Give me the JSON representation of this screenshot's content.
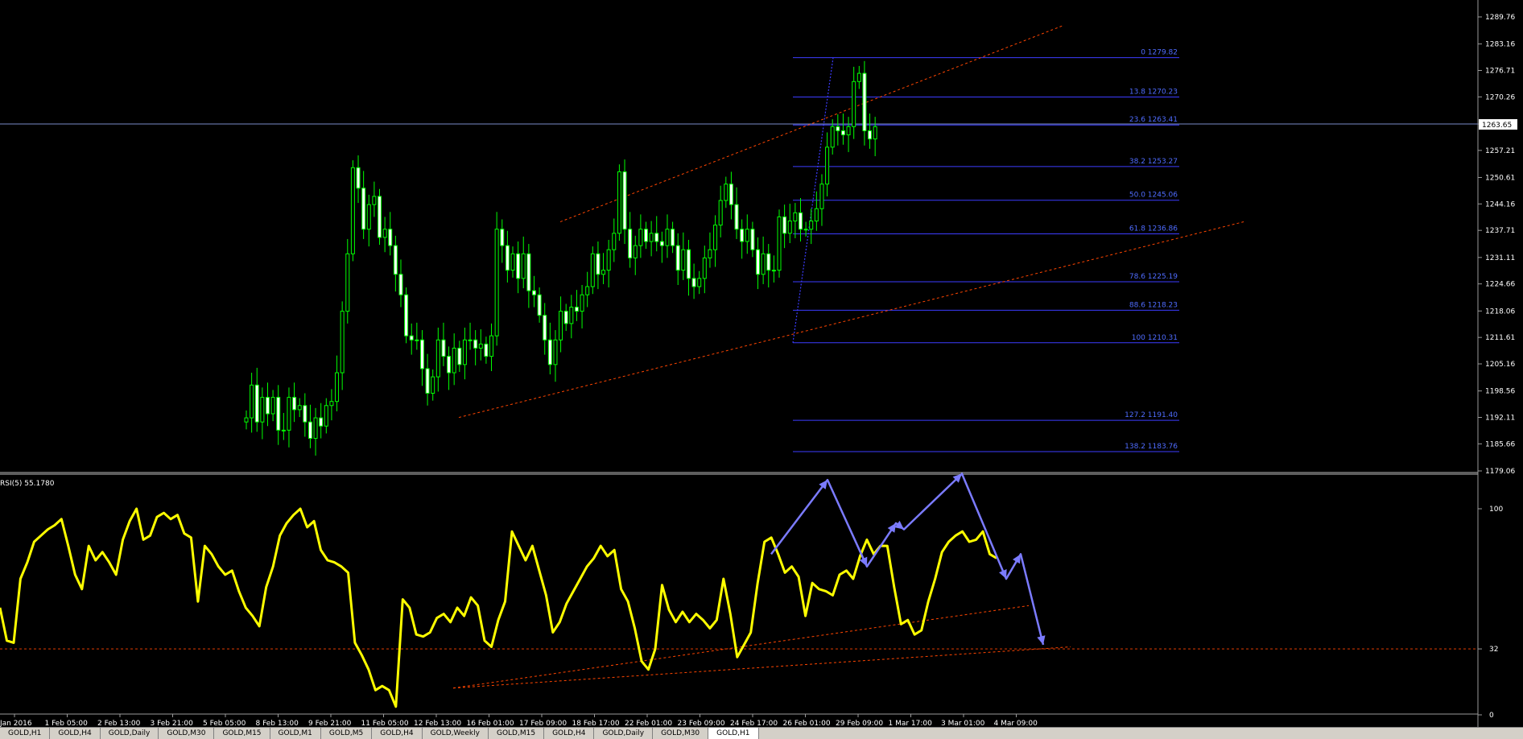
{
  "colors": {
    "background": "#000000",
    "bull_candle": "#00ff00",
    "bear_candle": "#ffffff",
    "fib_line": "#3c3cff",
    "fib_text": "#4f6cff",
    "trend_line": "#ff4500",
    "rsi_line": "#ffff00",
    "annotation_arrow": "#7b7bff",
    "axis_text": "#ffffff",
    "current_price_line": "#7a8cc8"
  },
  "chart_data": [
    {
      "type": "candlestick",
      "title": "",
      "ylim": [
        1179.06,
        1292.5
      ],
      "price_axis_ticks": [
        "1289.76",
        "1283.16",
        "1276.71",
        "1270.26",
        "1263.65",
        "1257.21",
        "1250.61",
        "1244.16",
        "1237.71",
        "1231.11",
        "1224.66",
        "1218.06",
        "1211.61",
        "1205.16",
        "1198.56",
        "1192.11",
        "1185.66",
        "1179.06"
      ],
      "current_price": "1263.65",
      "closes": [
        1192,
        1200,
        1191,
        1197,
        1193,
        1197,
        1189,
        1189,
        1197,
        1194,
        1195,
        1191,
        1187,
        1192,
        1190,
        1195,
        1196,
        1203,
        1218,
        1232,
        1253,
        1248,
        1238,
        1244,
        1246,
        1236,
        1238,
        1234,
        1227,
        1222,
        1212,
        1211,
        1211,
        1204,
        1198,
        1202,
        1211,
        1207,
        1203,
        1209,
        1205,
        1211,
        1211,
        1209,
        1210,
        1207,
        1212,
        1238,
        1234,
        1228,
        1232,
        1226,
        1232,
        1223,
        1222,
        1217,
        1211,
        1205,
        1211,
        1218,
        1215,
        1219,
        1218,
        1222,
        1224,
        1232,
        1227,
        1228,
        1233,
        1237,
        1252,
        1238,
        1231,
        1234,
        1238,
        1235,
        1237,
        1235,
        1234,
        1238,
        1234,
        1228,
        1233,
        1226,
        1224,
        1226,
        1231,
        1233,
        1239,
        1245,
        1249,
        1244,
        1238,
        1235,
        1238,
        1233,
        1227,
        1232,
        1228,
        1228,
        1241,
        1237,
        1240,
        1242,
        1238,
        1238,
        1240,
        1243,
        1249,
        1258,
        1263,
        1262,
        1261,
        1263,
        1274,
        1276,
        1262,
        1260,
        1263
      ],
      "fibonacci": [
        {
          "label": "0 1279.82",
          "value": 1279.82
        },
        {
          "label": "13.8 1270.23",
          "value": 1270.23
        },
        {
          "label": "23.6 1263.41",
          "value": 1263.41
        },
        {
          "label": "38.2 1253.27",
          "value": 1253.27
        },
        {
          "label": "50.0 1245.06",
          "value": 1245.06
        },
        {
          "label": "61.8 1236.86",
          "value": 1236.86
        },
        {
          "label": "78.6 1225.19",
          "value": 1225.19
        },
        {
          "label": "88.6 1218.23",
          "value": 1218.23
        },
        {
          "label": "100 1210.31",
          "value": 1210.31
        },
        {
          "label": "127.2 1191.40",
          "value": 1191.4
        },
        {
          "label": "138.2 1183.76",
          "value": 1183.76
        }
      ]
    },
    {
      "type": "line",
      "title": "RSI(5) 55.1780",
      "ylim": [
        0,
        100
      ],
      "y_ticks": [
        "100",
        "32",
        "0"
      ],
      "reference_level": 32,
      "values": [
        52,
        36,
        35,
        66,
        74,
        84,
        87,
        90,
        92,
        95,
        82,
        68,
        61,
        82,
        75,
        79,
        74,
        68,
        85,
        94,
        100,
        85,
        87,
        96,
        98,
        95,
        97,
        88,
        86,
        55,
        82,
        78,
        72,
        68,
        70,
        60,
        52,
        48,
        43,
        62,
        72,
        87,
        93,
        97,
        100,
        91,
        94,
        80,
        75,
        74,
        72,
        69,
        35,
        29,
        22,
        12,
        14,
        12,
        4,
        56,
        52,
        39,
        38,
        40,
        47,
        49,
        45,
        52,
        48,
        57,
        53,
        36,
        33,
        46,
        55,
        89,
        82,
        75,
        82,
        70,
        58,
        40,
        45,
        54,
        60,
        66,
        72,
        76,
        82,
        77,
        80,
        61,
        55,
        42,
        26,
        22,
        32,
        63,
        51,
        45,
        50,
        45,
        49,
        46,
        42,
        46,
        66,
        49,
        28,
        34,
        40,
        64,
        84,
        86,
        78,
        69,
        72,
        67,
        48,
        64,
        61,
        60,
        58,
        68,
        70,
        66,
        77,
        85,
        78,
        82,
        82,
        62,
        44,
        46,
        39,
        41,
        55,
        66,
        79,
        84,
        87,
        89,
        84,
        85,
        89,
        78,
        76
      ]
    }
  ],
  "x_axis_labels": [
    "Jan 2016",
    "1 Feb 05:00",
    "2 Feb 13:00",
    "3 Feb 21:00",
    "5 Feb 05:00",
    "8 Feb 13:00",
    "9 Feb 21:00",
    "11 Feb 05:00",
    "12 Feb 13:00",
    "16 Feb 01:00",
    "17 Feb 09:00",
    "18 Feb 17:00",
    "22 Feb 01:00",
    "23 Feb 09:00",
    "24 Feb 17:00",
    "26 Feb 01:00",
    "29 Feb 09:00",
    "1 Mar 17:00",
    "3 Mar 01:00",
    "4 Mar 09:00"
  ],
  "tabs": [
    "GOLD,H1",
    "GOLD,H4",
    "GOLD,Daily",
    "GOLD,M30",
    "GOLD,M15",
    "GOLD,M1",
    "GOLD,M5",
    "GOLD,H4",
    "GOLD,Weekly",
    "GOLD,M15",
    "GOLD,H4",
    "GOLD,Daily",
    "GOLD,M30",
    "GOLD,H1"
  ]
}
